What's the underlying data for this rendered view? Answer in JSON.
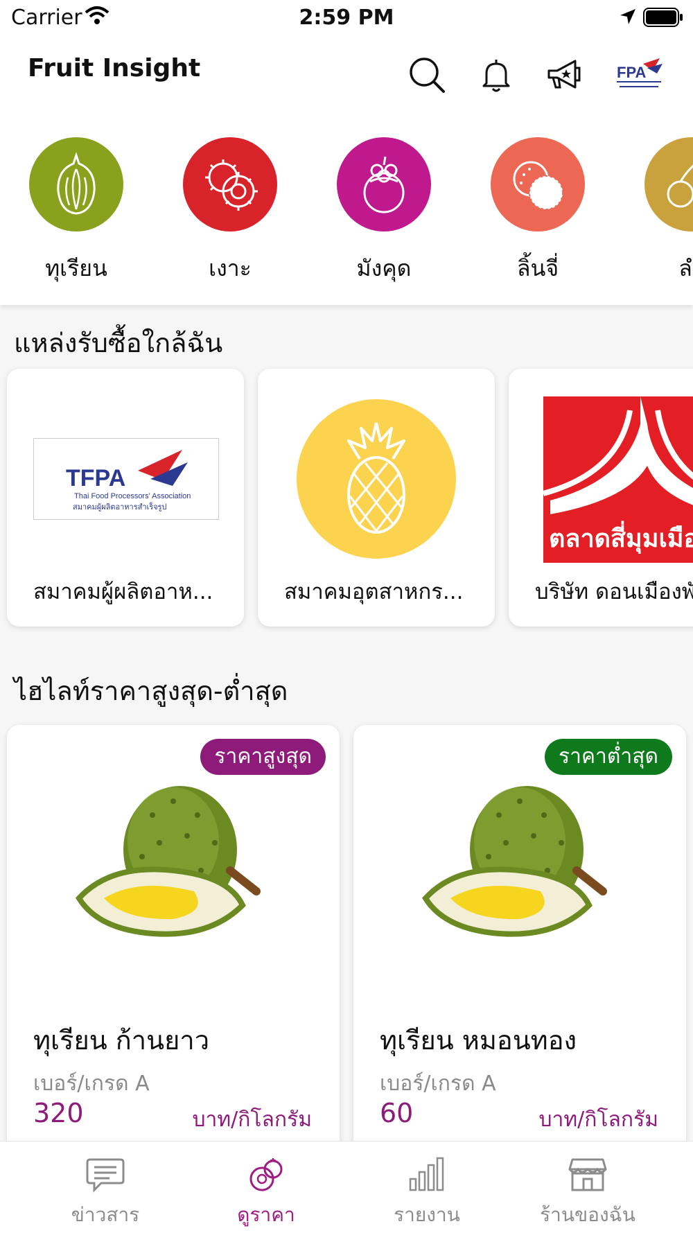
{
  "status_bar": {
    "carrier": "Carrier",
    "time": "2:59 PM"
  },
  "header": {
    "title": "Fruit Insight",
    "icons": [
      "search-icon",
      "bell-icon",
      "megaphone-icon"
    ],
    "logo_text": "FPA"
  },
  "categories": [
    {
      "label": "ทุเรียน",
      "color": "#8aa11d",
      "icon": "durian-icon"
    },
    {
      "label": "เงาะ",
      "color": "#d8232a",
      "icon": "rambutan-icon"
    },
    {
      "label": "มังคุด",
      "color": "#c0188d",
      "icon": "mangosteen-icon"
    },
    {
      "label": "ลิ้นจี่",
      "color": "#ec6754",
      "icon": "lychee-icon"
    },
    {
      "label": "ลำ",
      "color": "#c9a23d",
      "icon": "longan-icon"
    }
  ],
  "sources": {
    "title": "แหล่งรับซื้อใกล้ฉัน",
    "items": [
      {
        "name": "สมาคมผู้ผลิตอาห...",
        "logo_text": "TFPA",
        "logo_sub": "Thai Food Processors' Association",
        "logo_thai": "สมาคมผู้ผลิตอาหารสำเร็จรูป"
      },
      {
        "name": "สมาคมอุตสาหกร...",
        "logo_color": "#fcd34f"
      },
      {
        "name": "บริษัท ดอนเมืองพั",
        "logo_text": "ตลาดสี่มุมเมือ",
        "logo_color": "#e31e24"
      }
    ]
  },
  "highlights": {
    "title": "ไฮไลท์ราคาสูงสุด-ต่ำสุด",
    "items": [
      {
        "badge": "ราคาสูงสุด",
        "badge_color": "#8e1a7a",
        "name": "ทุเรียน ก้านยาว",
        "grade": "เบอร์/เกรด A",
        "price": "320",
        "unit": "บาท/กิโลกรัม"
      },
      {
        "badge": "ราคาต่ำสุด",
        "badge_color": "#0f7a1b",
        "name": "ทุเรียน หมอนทอง",
        "grade": "เบอร์/เกรด A",
        "price": "60",
        "unit": "บาท/กิโลกรัม"
      }
    ]
  },
  "tabs": [
    {
      "label": "ข่าวสาร",
      "icon": "news-icon",
      "active": false
    },
    {
      "label": "ดูราคา",
      "icon": "fruit-price-icon",
      "active": true
    },
    {
      "label": "รายงาน",
      "icon": "bar-chart-icon",
      "active": false
    },
    {
      "label": "ร้านของฉัน",
      "icon": "store-icon",
      "active": false
    }
  ]
}
